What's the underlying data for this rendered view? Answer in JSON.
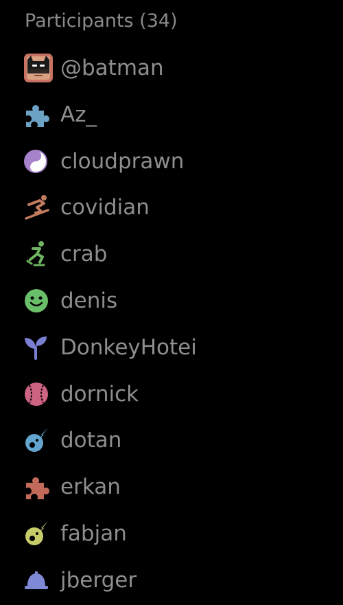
{
  "participants": {
    "header": "Participants (34)",
    "items": [
      {
        "name": "@batman",
        "icon": "batman-avatar-icon",
        "color": "#c87264"
      },
      {
        "name": "Az_",
        "icon": "puzzle-piece-icon",
        "color": "#6ca2c4"
      },
      {
        "name": "cloudprawn",
        "icon": "yin-yang-icon",
        "color": "#a782cc"
      },
      {
        "name": "covidian",
        "icon": "snowboarder-icon",
        "color": "#c27c60"
      },
      {
        "name": "crab",
        "icon": "ice-skater-icon",
        "color": "#70b561"
      },
      {
        "name": "denis",
        "icon": "smiley-face-icon",
        "color": "#69be6a"
      },
      {
        "name": "DonkeyHotei",
        "icon": "seedling-icon",
        "color": "#7a7fd1"
      },
      {
        "name": "dornick",
        "icon": "baseball-icon",
        "color": "#cc6381"
      },
      {
        "name": "dotan",
        "icon": "meteor-icon",
        "color": "#63a5cf"
      },
      {
        "name": "erkan",
        "icon": "puzzle-piece-icon",
        "color": "#c46a5a"
      },
      {
        "name": "fabjan",
        "icon": "meteor-icon",
        "color": "#c7cc6b"
      },
      {
        "name": "jberger",
        "icon": "hard-hat-icon",
        "color": "#7f8ad6"
      }
    ]
  }
}
